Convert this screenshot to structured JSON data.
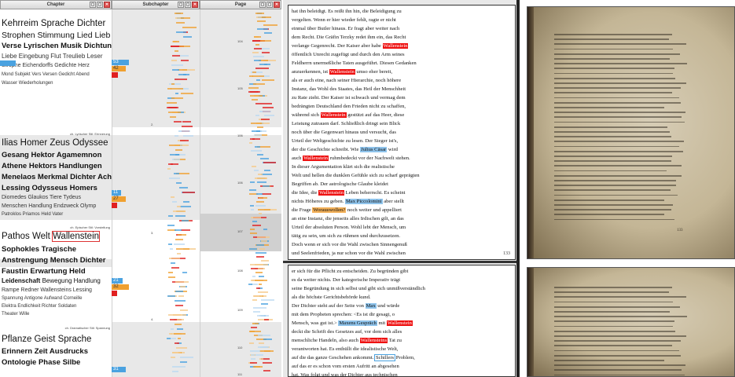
{
  "columns": {
    "chapter": "Chapter",
    "subchapter": "Subchapter",
    "page": "Page"
  },
  "header_buttons": [
    "▢",
    "▢",
    "✕"
  ],
  "chapters": [
    {
      "label": "ch. Lyrischer Stil: Erinnerung",
      "keywords": [
        "Kehrreim Sprache Dichter",
        "Strophen Stimmung Lied Lieb",
        "Verse Lyrischen Musik Dichtung",
        "Liebe Eingebung Flut Treulieb Leser",
        "Strophe Eichendorffs Gedichte Herz",
        "Mond Subjekt Vers Versen Gedicht Abend",
        "Wasser Wiederholungen"
      ],
      "bars": [
        {
          "v": "53",
          "c": "blue"
        },
        {
          "v": "42",
          "c": "orange"
        },
        {
          "v": "",
          "c": "red"
        }
      ],
      "subnum": "2.",
      "pages": [
        "104",
        "105",
        "106"
      ]
    },
    {
      "label": "ch. Epischer Stil: Vorstellung",
      "keywords": [
        "Ilias Homer Zeus Odyssee",
        "Gesang Hektor Agamemnon",
        "Athene Hektors Handlungen",
        "Menelaos Merkmal Dichter Achill",
        "Lessing Odysseus Homers",
        "Diomedes Glaukos Tiere Tydeus",
        "Menschen Handlung Endzweck Olymp",
        "Patroklos Priamos Held Vater"
      ],
      "bars": [
        {
          "v": "11",
          "c": "blue"
        },
        {
          "v": "27",
          "c": "orange"
        },
        {
          "v": "",
          "c": "red"
        }
      ],
      "subnum": "3.",
      "pages": [
        "106",
        "107"
      ]
    },
    {
      "label": "ch. Dramatischer Stil: Spannung",
      "keywords": [
        "Pathos Welt",
        "Wallenstein",
        "Sophokles Tragische",
        "Anstrengung Mensch Dichter",
        "Faustin Erwartung Held",
        "Leidenschaft",
        "Bewegung Handlung",
        "Rampe Redner Wallensteins Lessing",
        "Spannung Antigone Aufwand Corneille",
        "Elektra Endlichkeit Richter Soldaten",
        "Theater Wille"
      ],
      "bars": [
        {
          "v": "21",
          "c": "blue"
        },
        {
          "v": "32",
          "c": "orange"
        },
        {
          "v": "",
          "c": "red"
        }
      ],
      "subnum": "4.",
      "pages": [
        "108",
        "109",
        "110"
      ]
    },
    {
      "label": "",
      "keywords": [
        "Pflanze Geist Sprache",
        "Erinnern Zeit Ausdrucks",
        "Ontologie Phase Silbe"
      ],
      "bars": [
        {
          "v": "31",
          "c": "blue"
        }
      ],
      "subnum": "",
      "pages": [
        "111"
      ]
    }
  ],
  "text_page1": {
    "lines": [
      "hat ihn beleidigt. Es reißt ihn hin, die Beleidigung zu",
      "vergelten. Wenn er hier wieder fehlt, ragte er nicht",
      "einmal über Butler hinaus. Er fragt aber weiter nach",
      "dem Recht. Die Gräfin Terzky redet ihm ein, das Recht",
      "verlange Gegenrecht. Der Kaiser aber habe |Wallenstein|",
      "öffentlich Unrecht zugefügt und durch den Arm seines",
      "Feldherrn unermeßliche Taten ausgeführt. Diesen Gedanken",
      "anzuerkennen, ist |Wallenstein| umso eher bereit,",
      "als er auch eine, nach seiner Hierarchie, noch höhere",
      "Instanz, das Wohl des Staates, das Heil der Menschheit",
      "zu Rate zieht. Der Kaiser ist schwach und vermag dem",
      "bedrängten Deutschland den Frieden nicht zu schaffen,",
      "während sich |Wallenstein| gestützt auf das Heer, diese",
      "Leistung zutrauen darf. Schließlich dringt sein Blick",
      "noch über die Gegenwart hinaus und versucht, das",
      "Urteil der Weltgeschichte zu lesen. Der Sieger ist's,",
      "der die Geschichte schreibt. Wie {Julius Cäsar} wird",
      "auch |Wallenstein| ruhmbedeckt vor der Nachwelt stehen.",
      "    In dieser Argumentation klärt sich die realistische",
      "Welt und hellen die dunklen Gefühle sich zu scharf geprägten",
      "Begriffen ab. Der astrologische Glaube kleidet",
      "die Idee, die |Wallenstein| Leben beherrscht. Es scheint",
      "nichts Höheres zu geben. {Max Piccolomini} aber stellt",
      "die Frage <Worauswollen?> noch weiter und appelliert",
      "an eine Instanz, die jenseits alles Irdischen gilt, an das",
      "Urteil der absoluten Person. Wohl lebt der Mensch, um",
      "tätig zu sein, um sich zu rühmen und durchzusetzen.",
      "Doch wenn er sich vor die Wahl zwischen Sinnengenuß",
      "und Seelenfrieden, ja nur schon vor die Wahl zwischen",
      "irdischem Fortbestand und Pflicht gestellt sieht, so hat"
    ],
    "page_no": "133"
  },
  "text_page2": {
    "lines": [
      "er sich für die Pflicht zu entscheiden. Zu begründen gibt",
      "es da weiter nichts. Der kategorische Imperativ trägt",
      "seine Begründung in sich selbst und gibt sich unmißverständlich",
      "als die höchste Gerichtsbehörde kund.",
      "    Der Dichter steht auf der Seite von {Max} und würde",
      "mit dem Propheten sprechen: <Es ist dir gesagt, o",
      "Mensch, was gut ist.> {Maxens Gespräch} mit |Wallenstein|",
      "deckt die Schrift des Gesetzes auf, vor dem sich alles",
      "menschliche Handeln, also auch |Wallensteins| Tat zu",
      "verantworten hat. Es enthüllt die idealistische Welt,",
      "auf die das ganze Geschehen ankommt. [Schillers] Problem,",
      "auf das er es schon vom ersten Aufritt an abgesehen",
      "hat. Was folgt und was der Dichter aus technischen"
    ]
  },
  "scan_page_no": "133"
}
